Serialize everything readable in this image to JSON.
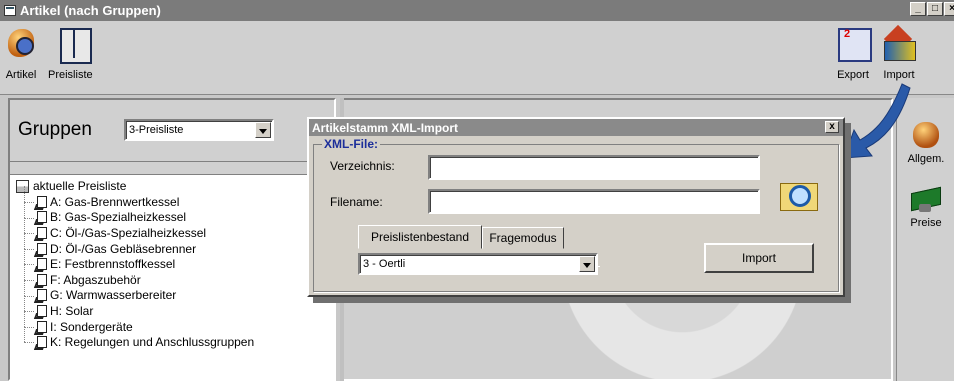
{
  "window": {
    "title": "Artikel (nach Gruppen)",
    "min_label": "_",
    "max_label": "□",
    "close_label": "×"
  },
  "toolbar": {
    "artikel_label": "Artikel",
    "preisliste_label": "Preisliste",
    "export_label": "Export",
    "import_label": "Import"
  },
  "groups": {
    "label": "Gruppen",
    "selected": "3-Preisliste"
  },
  "tree": {
    "root": "aktuelle Preisliste",
    "items": [
      "A: Gas-Brennwertkessel",
      "B: Gas-Spezialheizkessel",
      "C: Öl-/Gas-Spezialheizkessel",
      "D: Öl-/Gas Gebläsebrenner",
      "E: Festbrennstoffkessel",
      "F: Abgaszubehör",
      "G: Warmwasserbereiter",
      "H: Solar",
      "I: Sondergeräte",
      "K: Regelungen und Anschlussgruppen"
    ]
  },
  "rightnav": {
    "allgem_label": "Allgem.",
    "preise_label": "Preise"
  },
  "dialog": {
    "title": "Artikelstamm XML-Import",
    "close_label": "x",
    "group_label": "XML-File:",
    "verzeichnis_label": "Verzeichnis:",
    "verzeichnis_value": "",
    "filename_label": "Filename:",
    "filename_value": "",
    "tab1": "Preislistenbestand",
    "tab2": "Fragemodus",
    "select_value": "3 - Oertli",
    "import_button": "Import"
  },
  "colors": {
    "titlebar": "#7b7b7b",
    "dialog_title": "#8a8a8a",
    "group_legend": "#1c2e9a",
    "arrow": "#2a5aa8"
  }
}
